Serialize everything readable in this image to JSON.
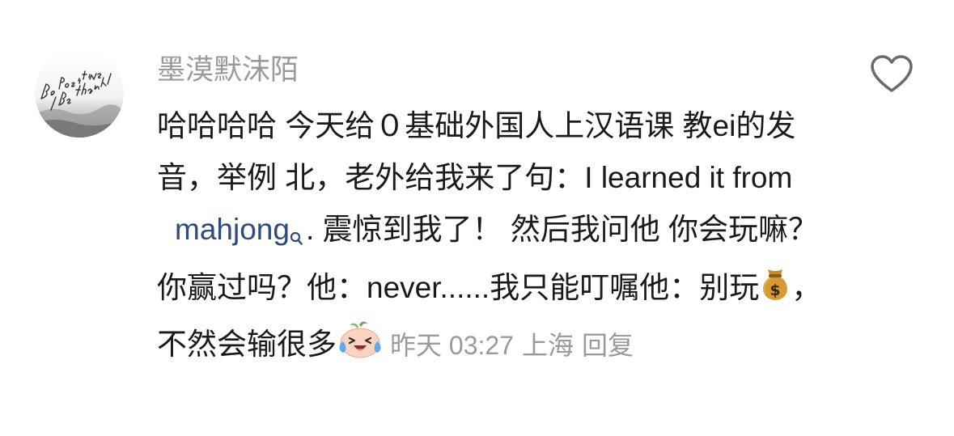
{
  "comment": {
    "username": "墨漠默沫陌",
    "avatar_icon": "be-positive-avatar-icon",
    "avatar_text": "Be positive Be thankful",
    "like_icon": "heart-outline-icon",
    "text_part1": "哈哈哈哈 今天给０基础外国人上汉语课 教ei的发音，举例 北，老外给我来了句：I learned it from",
    "link_text": "mahjong",
    "search_icon": "search-icon",
    "text_part2": ". 震惊到我了！ 然后我问他 你会玩嘛？你赢过吗？他：never......我只能叮嘱他：别玩",
    "money_bag_emoji": "money-bag-emoji-icon",
    "text_part3": "，不然会输很多",
    "crying_laughing_emoji": "laughing-crying-emoji-icon",
    "time_label": "昨天 03:27",
    "location": "上海",
    "reply_label": "回复"
  },
  "colors": {
    "username": "#9a9a9a",
    "text": "#1a1a1a",
    "link": "#2f4a7c",
    "meta": "#9a9a9a"
  }
}
